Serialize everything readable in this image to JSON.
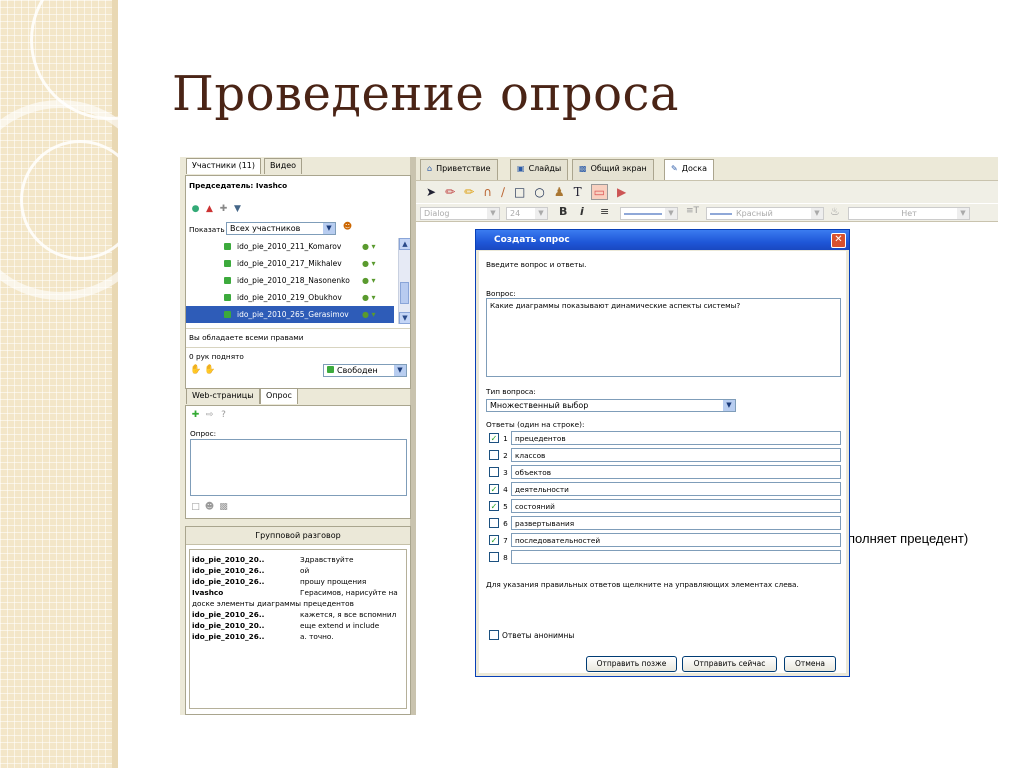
{
  "slide": {
    "title": "Проведение опроса"
  },
  "left": {
    "tabs": [
      "Участники (11)",
      "Видео"
    ],
    "chairman": "Председатель: Ivashco",
    "show_label": "Показать",
    "show_value": "Всех участников",
    "participants": [
      {
        "name": "ido_pie_2010_211_Komarov",
        "selected": false
      },
      {
        "name": "ido_pie_2010_217_Mikhalev",
        "selected": false
      },
      {
        "name": "ido_pie_2010_218_Nasonenko",
        "selected": false
      },
      {
        "name": "ido_pie_2010_219_Obukhov",
        "selected": false
      },
      {
        "name": "ido_pie_2010_265_Gerasimov",
        "selected": true
      }
    ],
    "rights_text": "Вы обладаете всеми правами",
    "hands_text": "0 рук поднято",
    "status_value": "Свободен",
    "tabs2": [
      "Web-страницы",
      "Опрос"
    ],
    "poll_label": "Опрос:",
    "chat_title": "Групповой разговор",
    "chat": [
      {
        "who": "ido_pie_2010_20..",
        "msg": "Здравствуйте"
      },
      {
        "who": "ido_pie_2010_26..",
        "msg": "ой"
      },
      {
        "who": "ido_pie_2010_26..",
        "msg": "прошу прощения"
      },
      {
        "who": "Ivashco",
        "msg": "Герасимов, нарисуйте на"
      },
      {
        "who": "",
        "msg": "доске элементы диаграммы прецедентов"
      },
      {
        "who": "ido_pie_2010_26..",
        "msg": "кажется, я все вспомнил"
      },
      {
        "who": "ido_pie_2010_20..",
        "msg": "еще extend и include"
      },
      {
        "who": "ido_pie_2010_26..",
        "msg": "а. точно."
      }
    ]
  },
  "right": {
    "tabs": [
      {
        "label": "Приветствие",
        "icon": "home-icon"
      },
      {
        "label": "Слайды",
        "icon": "slides-icon"
      },
      {
        "label": "Общий экран",
        "icon": "screen-icon"
      },
      {
        "label": "Доска",
        "icon": "whiteboard-icon"
      }
    ],
    "font_family": "Dialog",
    "font_size": "24",
    "color_name": "Красный",
    "fill_value": "Нет",
    "behind_text": "полняет прецедент)"
  },
  "dialog": {
    "title": "Создать опрос",
    "intro": "Введите вопрос и ответы.",
    "question_label": "Вопрос:",
    "question_text": "Какие диаграммы показывают динамические аспекты системы?",
    "type_label": "Тип вопроса:",
    "type_value": "Множественный выбор",
    "answers_label": "Ответы (один на строке):",
    "answers": [
      {
        "num": "1",
        "text": "прецедентов",
        "checked": true
      },
      {
        "num": "2",
        "text": "классов",
        "checked": false
      },
      {
        "num": "3",
        "text": "объектов",
        "checked": false
      },
      {
        "num": "4",
        "text": "деятельности",
        "checked": true
      },
      {
        "num": "5",
        "text": "состояний",
        "checked": true
      },
      {
        "num": "6",
        "text": "развертывания",
        "checked": false
      },
      {
        "num": "7",
        "text": "последовательностей",
        "checked": true
      },
      {
        "num": "8",
        "text": "",
        "checked": false
      }
    ],
    "hint": "Для указания правильных ответов щелкните на управляющих элементах слева.",
    "anonymous_label": "Ответы анонимны",
    "buttons": {
      "later": "Отправить позже",
      "now": "Отправить сейчас",
      "cancel": "Отмена"
    }
  }
}
